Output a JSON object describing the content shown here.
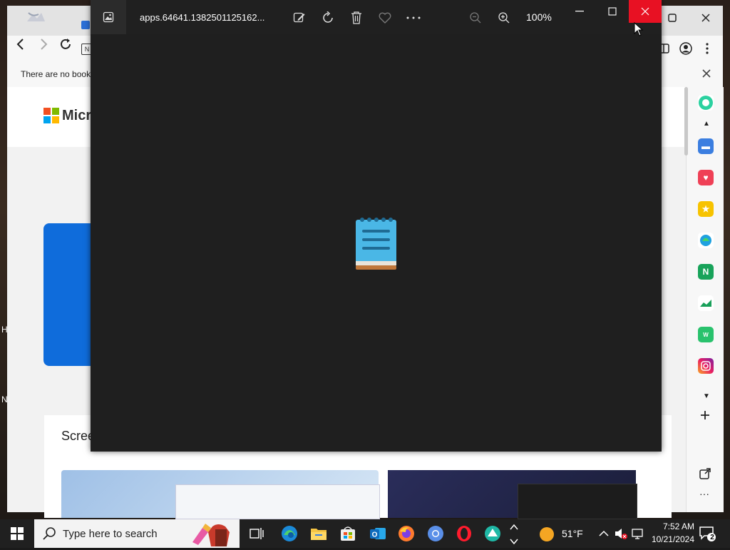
{
  "browser": {
    "bookmarks_bar_text": "There are no book",
    "ms_word": "Micr",
    "section_title": "Scree",
    "desk_letter_1": "H",
    "desk_letter_2": "N",
    "address_frag": "N"
  },
  "viewer": {
    "filename": "apps.64641.1382501125162...",
    "zoom_level": "100%",
    "toolbar": {
      "edit_icon": "edit-icon",
      "rotate_icon": "rotate-icon",
      "delete_icon": "delete-icon",
      "favorite_icon": "heart-icon",
      "more_icon": "more-icon",
      "zoom_out_icon": "zoom-out-icon",
      "zoom_in_icon": "zoom-in-icon"
    }
  },
  "taskbar": {
    "search_placeholder": "Type here to search",
    "weather_temp": "51°F",
    "time": "7:52 AM",
    "date": "10/21/2024",
    "notifications_count": "2"
  },
  "colors": {
    "close_red": "#e81123",
    "viewer_bg": "#1f1f1f",
    "taskbar_bg": "#202020"
  }
}
